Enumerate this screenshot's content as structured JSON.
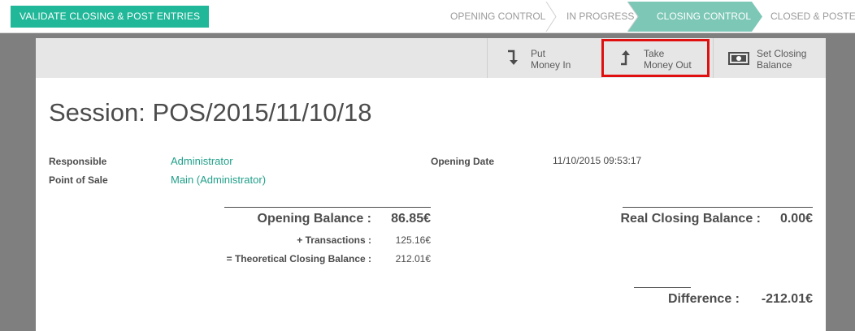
{
  "statusbar": {
    "validate_label": "VALIDATE CLOSING & POST ENTRIES",
    "steps": [
      {
        "label": "OPENING CONTROL",
        "active": false
      },
      {
        "label": "IN PROGRESS",
        "active": false
      },
      {
        "label": "CLOSING CONTROL",
        "active": true
      },
      {
        "label": "CLOSED & POSTED",
        "active": false
      }
    ]
  },
  "header_buttons": {
    "put_money_in": {
      "line1": "Put",
      "line2": "Money In"
    },
    "take_money_out": {
      "line1": "Take",
      "line2": "Money Out"
    },
    "set_closing_balance": {
      "line1": "Set Closing",
      "line2": "Balance"
    }
  },
  "session": {
    "title": "Session: POS/2015/11/10/18",
    "responsible_label": "Responsible",
    "responsible_value": "Administrator",
    "pos_label": "Point of Sale",
    "pos_value": "Main (Administrator)",
    "opening_date_label": "Opening Date",
    "opening_date_value": "11/10/2015 09:53:17"
  },
  "balances": {
    "opening_label": "Opening Balance :",
    "opening_value": "86.85€",
    "transactions_label": "+ Transactions :",
    "transactions_value": "125.16€",
    "theoretical_label": "= Theoretical Closing Balance :",
    "theoretical_value": "212.01€",
    "real_closing_label": "Real Closing Balance :",
    "real_closing_value": "0.00€",
    "difference_label": "Difference :",
    "difference_value": "-212.01€"
  },
  "colors": {
    "accent": "#21b799",
    "active_step": "#7cc7b6",
    "highlight": "#e01010"
  }
}
